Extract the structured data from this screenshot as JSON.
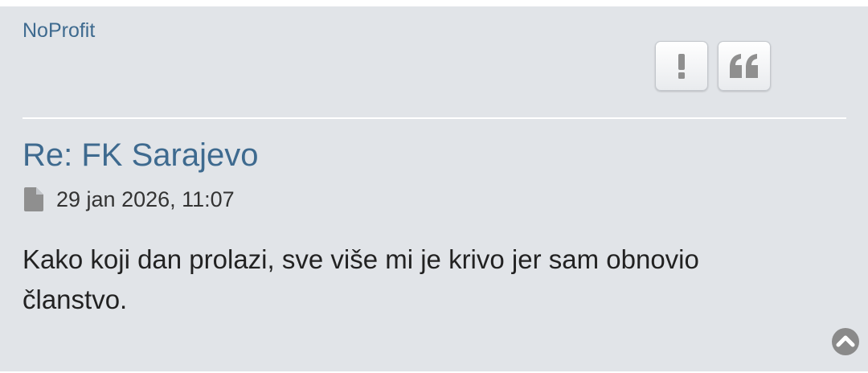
{
  "post": {
    "author": "NoProfit",
    "title": "Re: FK Sarajevo",
    "timestamp": "29 jan 2026, 11:07",
    "content": "Kako koji dan prolazi, sve više mi je krivo jer sam obnovio članstvo."
  },
  "buttons": {
    "report_icon": "exclamation-icon",
    "quote_icon": "quote-icon",
    "top_icon": "chevron-up-circle-icon"
  },
  "colors": {
    "background": "#e1e4e8",
    "link": "#3e6a8f",
    "icon": "#8f8f8f",
    "text": "#222222"
  }
}
